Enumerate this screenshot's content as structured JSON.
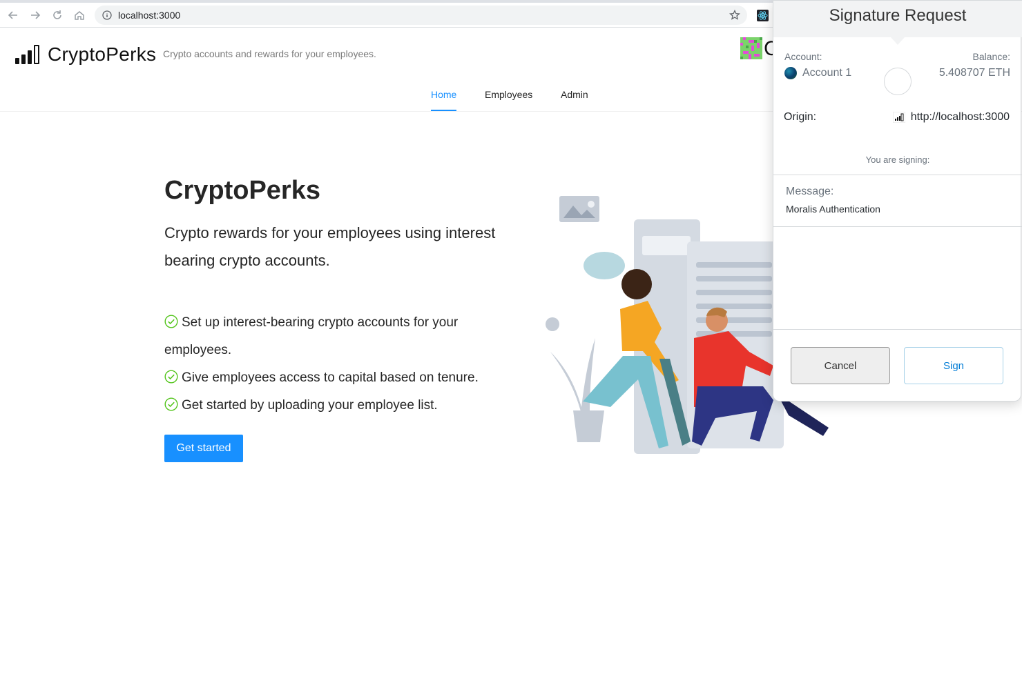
{
  "browser": {
    "url": "localhost:3000",
    "icons": [
      "back-icon",
      "forward-icon",
      "reload-icon",
      "home-icon",
      "info-icon",
      "bookmark-star-icon",
      "react-devtools-icon"
    ]
  },
  "header": {
    "brand": "CryptoPerks",
    "tagline": "Crypto accounts and rewards for your employees.",
    "avatar_letter": "C",
    "nav": [
      {
        "label": "Home",
        "active": true
      },
      {
        "label": "Employees",
        "active": false
      },
      {
        "label": "Admin",
        "active": false
      }
    ]
  },
  "hero": {
    "title": "CryptoPerks",
    "subtitle": "Crypto rewards for your employees using interest bearing crypto accounts.",
    "bullets": [
      "Set up interest-bearing crypto accounts for your employees.",
      "Give employees access to capital based on tenure.",
      "Get started by uploading your employee list."
    ],
    "cta": "Get started"
  },
  "signature_request": {
    "title": "Signature Request",
    "account_label": "Account:",
    "account_name": "Account 1",
    "balance_label": "Balance:",
    "balance": "5.408707 ETH",
    "origin_label": "Origin:",
    "origin": "http://localhost:3000",
    "signing_label": "You are signing:",
    "message_label": "Message:",
    "message": "Moralis Authentication",
    "cancel": "Cancel",
    "sign": "Sign"
  },
  "colors": {
    "primary": "#1890ff",
    "check": "#52c41a",
    "metamask_blue": "#037dd6"
  }
}
